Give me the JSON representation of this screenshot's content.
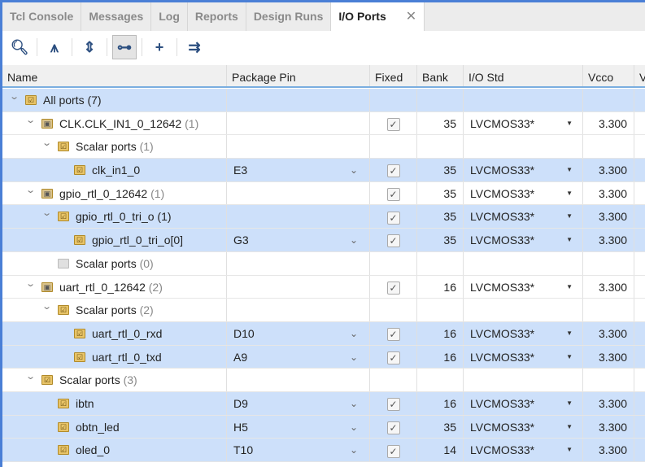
{
  "tabs": [
    {
      "label": "Tcl Console"
    },
    {
      "label": "Messages"
    },
    {
      "label": "Log"
    },
    {
      "label": "Reports"
    },
    {
      "label": "Design Runs"
    },
    {
      "label": "I/O Ports",
      "active": true
    }
  ],
  "close_glyph": "✕",
  "toolbar": [
    {
      "name": "search-icon",
      "glyph": "🔍︎"
    },
    {
      "name": "collapse-all-icon",
      "glyph": "⩚"
    },
    {
      "name": "expand-all-icon",
      "glyph": "⇕"
    },
    {
      "name": "group-by-interface-icon",
      "glyph": "⊶",
      "active": true
    },
    {
      "name": "add-icon",
      "glyph": "+"
    },
    {
      "name": "auto-assign-icon",
      "glyph": "⇉"
    }
  ],
  "columns": [
    "Name",
    "Package Pin",
    "Fixed",
    "Bank",
    "I/O Std",
    "Vcco",
    "V"
  ],
  "rows": [
    {
      "level": 0,
      "expand": true,
      "icon": "folder",
      "name": "All ports",
      "count": "(7)",
      "count_plain": true,
      "selected": true
    },
    {
      "level": 1,
      "expand": true,
      "icon": "bus",
      "name": "CLK.CLK_IN1_0_12642",
      "count": "(1)",
      "fixed": true,
      "bank": "35",
      "iostd": "LVCMOS33*",
      "vcco": "3.300"
    },
    {
      "level": 2,
      "expand": true,
      "icon": "folder",
      "name": "Scalar ports",
      "count": "(1)"
    },
    {
      "level": 3,
      "icon": "in",
      "name": "clk_in1_0",
      "pin": "E3",
      "fixed": true,
      "bank": "35",
      "iostd": "LVCMOS33*",
      "vcco": "3.300",
      "selected": true
    },
    {
      "level": 1,
      "expand": true,
      "icon": "bus",
      "name": "gpio_rtl_0_12642",
      "count": "(1)",
      "fixed": true,
      "bank": "35",
      "iostd": "LVCMOS33*",
      "vcco": "3.300"
    },
    {
      "level": 2,
      "expand": true,
      "icon": "busport",
      "name": "gpio_rtl_0_tri_o",
      "count": "(1)",
      "count_plain": true,
      "fixed": true,
      "bank": "35",
      "iostd": "LVCMOS33*",
      "vcco": "3.300",
      "selected": true
    },
    {
      "level": 3,
      "icon": "out",
      "name": "gpio_rtl_0_tri_o[0]",
      "pin": "G3",
      "fixed": true,
      "bank": "35",
      "iostd": "LVCMOS33*",
      "vcco": "3.300",
      "selected": true
    },
    {
      "level": 2,
      "icon": "empty",
      "name": "Scalar ports",
      "count": "(0)"
    },
    {
      "level": 1,
      "expand": true,
      "icon": "bus",
      "name": "uart_rtl_0_12642",
      "count": "(2)",
      "fixed": true,
      "bank": "16",
      "iostd": "LVCMOS33*",
      "vcco": "3.300"
    },
    {
      "level": 2,
      "expand": true,
      "icon": "folder",
      "name": "Scalar ports",
      "count": "(2)"
    },
    {
      "level": 3,
      "icon": "in",
      "name": "uart_rtl_0_rxd",
      "pin": "D10",
      "fixed": true,
      "bank": "16",
      "iostd": "LVCMOS33*",
      "vcco": "3.300",
      "selected": true
    },
    {
      "level": 3,
      "icon": "out",
      "name": "uart_rtl_0_txd",
      "pin": "A9",
      "fixed": true,
      "bank": "16",
      "iostd": "LVCMOS33*",
      "vcco": "3.300",
      "selected": true
    },
    {
      "level": 1,
      "expand": true,
      "icon": "folder",
      "name": "Scalar ports",
      "count": "(3)"
    },
    {
      "level": 2,
      "icon": "in",
      "name": "ibtn",
      "pin": "D9",
      "fixed": true,
      "bank": "16",
      "iostd": "LVCMOS33*",
      "vcco": "3.300",
      "selected": true
    },
    {
      "level": 2,
      "icon": "out",
      "name": "obtn_led",
      "pin": "H5",
      "fixed": true,
      "bank": "35",
      "iostd": "LVCMOS33*",
      "vcco": "3.300",
      "selected": true
    },
    {
      "level": 2,
      "icon": "out",
      "name": "oled_0",
      "pin": "T10",
      "fixed": true,
      "bank": "14",
      "iostd": "LVCMOS33*",
      "vcco": "3.300",
      "selected": true
    }
  ]
}
